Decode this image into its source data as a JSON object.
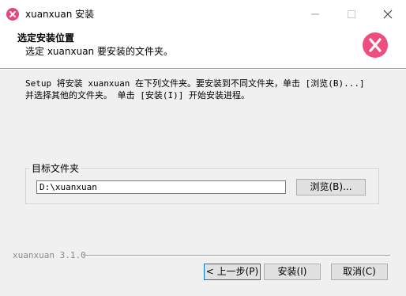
{
  "window": {
    "title": "xuanxuan 安装",
    "min_icon": "minimize-icon",
    "max_icon": "maximize-icon",
    "close_icon": "close-icon"
  },
  "header": {
    "title": "选定安装位置",
    "subtitle": "选定 xuanxuan 要安装的文件夹。",
    "logo_icon": "xuanxuan-logo-icon"
  },
  "description": "Setup 将安装 xuanxuan 在下列文件夹。要安装到不同文件夹，单击 [浏览(B)...]\n并选择其他的文件夹。 单击 [安装(I)] 开始安装进程。",
  "destination": {
    "label": "目标文件夹",
    "path": "D:\\xuanxuan",
    "browse_label": "浏览(B)..."
  },
  "footer": {
    "version": "xuanxuan 3.1.0",
    "back_label": "< 上一步(P)",
    "install_label": "安装(I)",
    "cancel_label": "取消(C)"
  },
  "colors": {
    "brand": "#ee4d7e"
  }
}
